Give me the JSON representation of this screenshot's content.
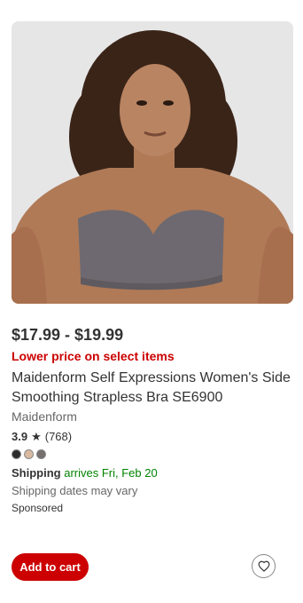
{
  "product": {
    "image_alt": "Woman wearing a gray strapless bra",
    "price": "$17.99 - $19.99",
    "promo": "Lower price on select items",
    "title": "Maidenform Self Expressions Women's Side Smoothing Strapless Bra SE6900",
    "brand": "Maidenform",
    "rating_score": "3.9",
    "rating_count": "(768)",
    "swatches": [
      "#2b2b2b",
      "#d9b9a0",
      "#75706e"
    ],
    "shipping_label": "Shipping",
    "shipping_arrival": "arrives Fri, Feb 20",
    "shipping_note": "Shipping dates may vary",
    "sponsored": "Sponsored"
  },
  "actions": {
    "add_to_cart": "Add to cart",
    "favorite_icon": "heart-icon"
  },
  "colors": {
    "accent": "#cc0000",
    "shipping_green": "#008300"
  }
}
